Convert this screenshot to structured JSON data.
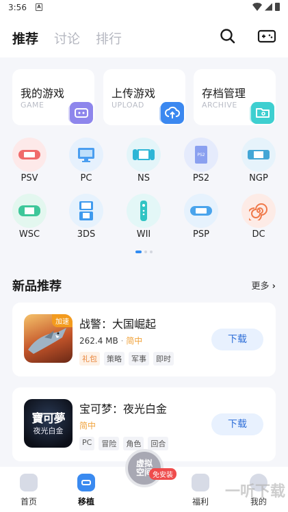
{
  "status": {
    "time": "3:56",
    "a_glyph": "A"
  },
  "header": {
    "tabs": [
      {
        "label": "推荐",
        "active": true
      },
      {
        "label": "讨论",
        "active": false
      },
      {
        "label": "排行",
        "active": false
      }
    ],
    "icons": [
      "search-icon",
      "gamepad-icon"
    ]
  },
  "quick": [
    {
      "title": "我的游戏",
      "sub": "GAME",
      "icon": "gamepad-icon",
      "color": "#8e86ec"
    },
    {
      "title": "上传游戏",
      "sub": "UPLOAD",
      "icon": "cloud-upload-icon",
      "color": "#3b88f0"
    },
    {
      "title": "存档管理",
      "sub": "ARCHIVE",
      "icon": "folder-icon",
      "color": "#3ecfd0"
    }
  ],
  "platforms": [
    {
      "label": "PSV",
      "bg": "#fde9e9",
      "fg": "#f06b6b"
    },
    {
      "label": "PC",
      "bg": "#e6f1fd",
      "fg": "#4a9ef0"
    },
    {
      "label": "NS",
      "bg": "#e3f5f9",
      "fg": "#2eb6d6"
    },
    {
      "label": "PS2",
      "bg": "#e5ebfc",
      "fg": "#6a86ea",
      "inner_text": "PS2"
    },
    {
      "label": "NGP",
      "bg": "#e6f3fb",
      "fg": "#43a6d6"
    },
    {
      "label": "WSC",
      "bg": "#e3f7ef",
      "fg": "#3ec79a"
    },
    {
      "label": "3DS",
      "bg": "#e6f2fd",
      "fg": "#3e9aee"
    },
    {
      "label": "WII",
      "bg": "#e3f7f7",
      "fg": "#31c4c4"
    },
    {
      "label": "PSP",
      "bg": "#e6f2fd",
      "fg": "#4aa4ec"
    },
    {
      "label": "DC",
      "bg": "#fdebe6",
      "fg": "#f07848"
    }
  ],
  "section": {
    "title": "新品推荐",
    "more": "更多"
  },
  "games": [
    {
      "name": "战警：大国崛起",
      "size": "262.4 MB",
      "sep": "·",
      "lang": "简中",
      "tags": [
        {
          "text": "礼包",
          "gift": true
        },
        {
          "text": "策略",
          "gift": false
        },
        {
          "text": "军事",
          "gift": false
        },
        {
          "text": "即时",
          "gift": false
        }
      ],
      "button": "下载",
      "thumb_badge": "加速"
    },
    {
      "name": "宝可梦：夜光白金",
      "size": "",
      "lang": "简中",
      "tags": [
        {
          "text": "PC",
          "gift": false
        },
        {
          "text": "冒险",
          "gift": false
        },
        {
          "text": "角色",
          "gift": false
        },
        {
          "text": "回合",
          "gift": false
        }
      ],
      "button": "下载",
      "thumb_title": "寶可夢",
      "thumb_sub": "夜光白金"
    }
  ],
  "bottom_nav": {
    "items": [
      {
        "label": "首页",
        "icon": "home-icon"
      },
      {
        "label": "移植",
        "icon": "port-icon",
        "active": true
      },
      {
        "label": "福利",
        "icon": "gift-icon"
      },
      {
        "label": "我的",
        "icon": "profile-icon"
      }
    ],
    "center": {
      "line1": "虚拟",
      "line2": "空间",
      "badge": "免安装"
    }
  },
  "watermark": "一听下载"
}
